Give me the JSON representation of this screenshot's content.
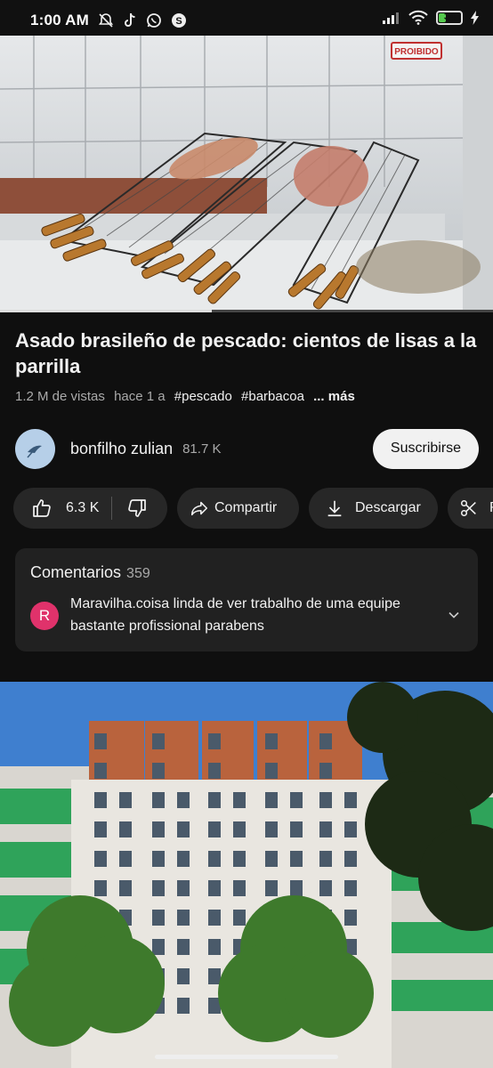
{
  "status_bar": {
    "time": "1:00 AM",
    "battery": "34",
    "icons": [
      "muted-bell-icon",
      "tiktok-icon",
      "whatsapp-icon",
      "skype-icon",
      "signal-icon",
      "wifi-icon",
      "battery-icon",
      "charging-icon"
    ]
  },
  "video": {
    "sign_text": "PROIBIDO",
    "progress_fraction": 0.43
  },
  "title": "Asado brasileño de pescado: cientos de lisas a la parrilla",
  "meta": {
    "views": "1.2 M de vistas",
    "age": "hace 1 a",
    "tag1": "#pescado",
    "tag2": "#barbacoa",
    "more": "... más"
  },
  "channel": {
    "name": "bonfilho zulian",
    "subscribers": "81.7 K",
    "subscribe_label": "Suscribirse"
  },
  "actions": {
    "like_count": "6.3 K",
    "share_label": "Compartir",
    "download_label": "Descargar",
    "clip_label": "R"
  },
  "comments": {
    "heading": "Comentarios",
    "count": "359",
    "avatar_letter": "R",
    "avatar_color": "#e0326b",
    "text": "Maravilha.coisa linda de ver trabalho de uma equipe bastante profissional parabens"
  },
  "colors": {
    "background": "#0f0f0f",
    "pill": "#272727",
    "card": "#212121",
    "secondary_text": "#aaaaaa"
  }
}
